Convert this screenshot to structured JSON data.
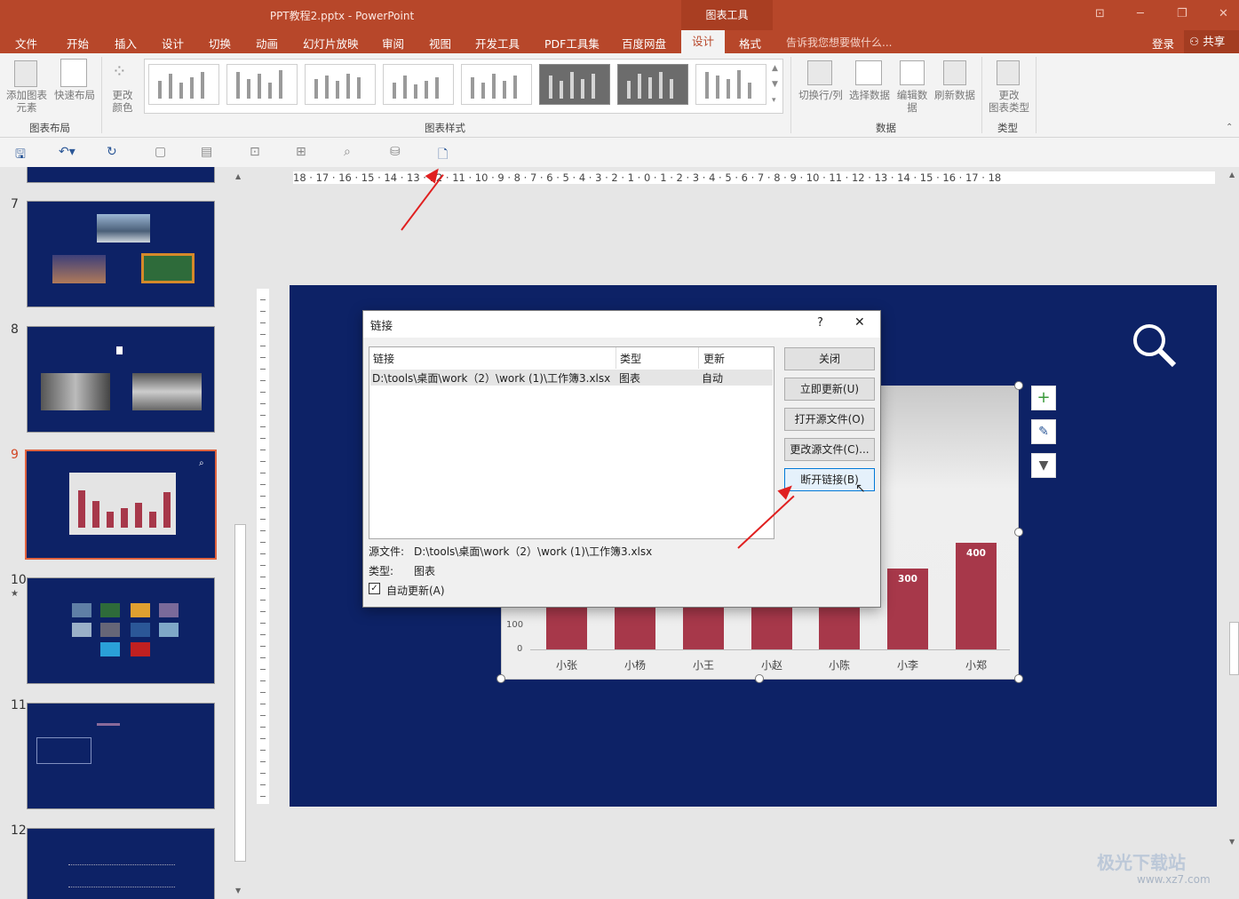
{
  "window": {
    "title": "PPT教程2.pptx - PowerPoint",
    "context_tab": "图表工具",
    "minimize": "─",
    "restore": "❐",
    "close": "✕",
    "ribbon_opt": "⊡"
  },
  "menu": {
    "items": [
      "文件",
      "开始",
      "插入",
      "设计",
      "切换",
      "动画",
      "幻灯片放映",
      "审阅",
      "视图",
      "开发工具",
      "PDF工具集",
      "百度网盘"
    ],
    "active": "设计",
    "format": "格式",
    "tell_me": "告诉我您想要做什么...",
    "login": "登录",
    "share": "共享"
  },
  "ribbon": {
    "add_element": "添加图表",
    "add_element2": "元素",
    "quick_layout": "快速布局",
    "change_color": "更改",
    "change_color2": "颜色",
    "group_layout": "图表布局",
    "group_styles": "图表样式",
    "switch_row_col": "切换行/列",
    "select_data": "选择数据",
    "edit_data": "编辑数",
    "edit_data2": "据",
    "refresh_data": "刷新数据",
    "group_data": "数据",
    "change_type": "更改",
    "change_type2": "图表类型",
    "group_type": "类型"
  },
  "panel": {
    "slide_numbers": [
      "7",
      "8",
      "9",
      "10",
      "11",
      "12"
    ],
    "star": "★"
  },
  "hruler": "18 · 17 · 16 · 15 · 14 · 13 · 12 · 11 · 10 · 9 · 8 · 7 · 6 · 5 · 4 · 3 · 2 · 1 · 0 · 1 · 2 · 3 · 4 · 5 · 6 · 7 · 8 · 9 · 10 · 11 · 12 · 13 · 14 · 15 · 16 · 17 · 18",
  "chart_data": {
    "type": "bar",
    "categories": [
      "小张",
      "小杨",
      "小王",
      "小赵",
      "小陈",
      "小李",
      "小郑"
    ],
    "visible_labels": [
      "300",
      "400"
    ],
    "ytick_labels": [
      "100",
      "0"
    ],
    "values": [
      150,
      140,
      120,
      135,
      150,
      300,
      400
    ],
    "ylim": [
      0,
      450
    ],
    "bar_color": "#a7384a"
  },
  "dialog": {
    "title": "链接",
    "help": "?",
    "close": "✕",
    "col_link": "链接",
    "col_type": "类型",
    "col_update": "更新",
    "row_link": "D:\\tools\\桌面\\work（2）\\work (1)\\工作簿3.xlsx",
    "row_type": "图表",
    "row_update": "自动",
    "source_label": "源文件:",
    "source_value": "D:\\tools\\桌面\\work（2）\\work (1)\\工作簿3.xlsx",
    "type_label": "类型:",
    "type_value": "图表",
    "auto_update": "自动更新(A)",
    "check": "✓",
    "btn_close": "关闭",
    "btn_update": "立即更新(U)",
    "btn_open": "打开源文件(O)",
    "btn_change": "更改源文件(C)...",
    "btn_break": "断开链接(B)"
  },
  "watermark": {
    "name": "极光下载站",
    "url": "www.xz7.com"
  }
}
